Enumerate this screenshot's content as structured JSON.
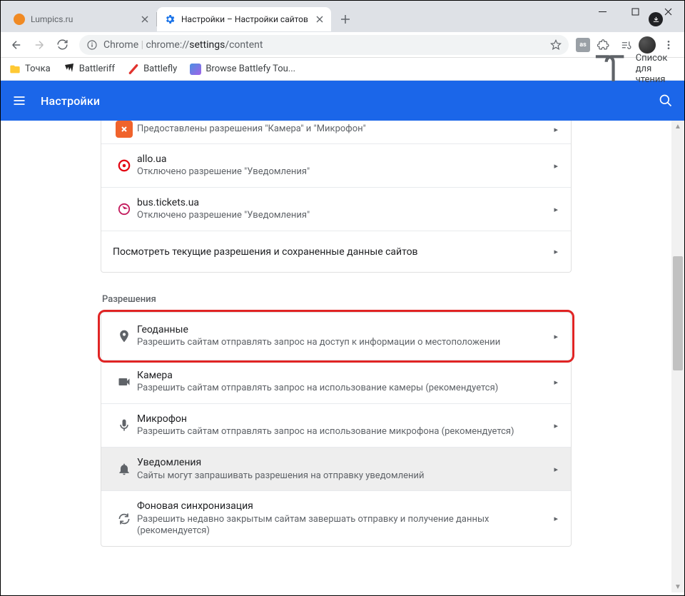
{
  "tabs": [
    {
      "title": "Lumpics.ru",
      "favicon_bg": "#f08a24",
      "active": false
    },
    {
      "title": "Настройки – Настройки сайтов",
      "favicon_type": "gear",
      "favicon_color": "#1a73e8",
      "active": true
    }
  ],
  "toolbar": {
    "chrome_label": "Chrome",
    "sep": "|",
    "url_prefix": "chrome://",
    "url_bold": "settings",
    "url_suffix": "/content",
    "ext_label": "as"
  },
  "bookmarks": [
    {
      "label": "Точка",
      "icon": "folder",
      "color": "#ffc933"
    },
    {
      "label": "Battleriff",
      "icon": "claws",
      "color": "#222"
    },
    {
      "label": "Battlefly",
      "icon": "slash",
      "color": "#e1332e"
    },
    {
      "label": "Browse Battlefy Tou...",
      "icon": "grid",
      "color": "#4a90e2"
    }
  ],
  "reading_list": "Список для чтения",
  "settings": {
    "title": "Настройки"
  },
  "recent_sites": [
    {
      "desc": "Предоставлены разрешения \"Камера\" и \"Микрофон\"",
      "favicon": "x-orange"
    },
    {
      "name": "allo.ua",
      "desc": "Отключено разрешение \"Уведомления\"",
      "favicon": "target-red"
    },
    {
      "name": "bus.tickets.ua",
      "desc": "Отключено разрешение \"Уведомления\"",
      "favicon": "arrow-magenta"
    }
  ],
  "all_sites_row": "Посмотреть текущие разрешения и сохраненные данные сайтов",
  "permissions_section": "Разрешения",
  "permissions": [
    {
      "icon": "location",
      "title": "Геоданные",
      "desc": "Разрешить сайтам отправлять запрос на доступ к информации о местоположении",
      "highlighted": true
    },
    {
      "icon": "camera",
      "title": "Камера",
      "desc": "Разрешить сайтам отправлять запрос на использование камеры (рекомендуется)"
    },
    {
      "icon": "mic",
      "title": "Микрофон",
      "desc": "Разрешить сайтам отправлять запрос на использование микрофона (рекомендуется)"
    },
    {
      "icon": "bell",
      "title": "Уведомления",
      "desc": "Сайты могут запрашивать разрешения на отправку уведомлений",
      "hl": true
    },
    {
      "icon": "sync",
      "title": "Фоновая синхронизация",
      "desc": "Разрешить недавно закрытым сайтам завершать отправку и получение данных (рекомендуется)"
    }
  ]
}
